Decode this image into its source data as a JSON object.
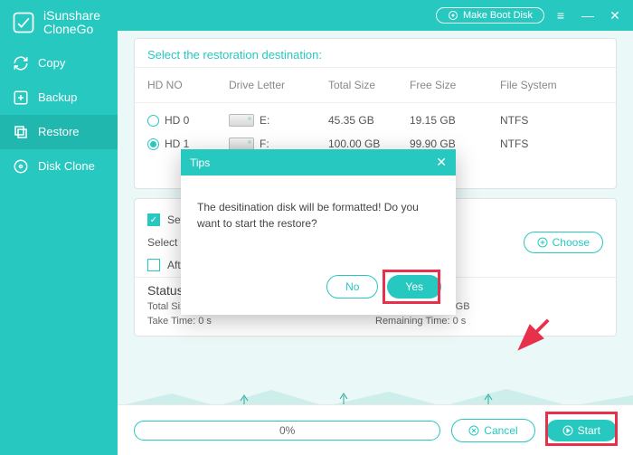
{
  "app": {
    "name1": "iSunshare",
    "name2": "CloneGo"
  },
  "topbar": {
    "boot": "Make Boot Disk"
  },
  "sidebar": {
    "items": [
      {
        "label": "Copy"
      },
      {
        "label": "Backup"
      },
      {
        "label": "Restore"
      },
      {
        "label": "Disk Clone"
      }
    ]
  },
  "table": {
    "title": "Select the restoration destination:",
    "headers": {
      "hd": "HD NO",
      "dl": "Drive Letter",
      "ts": "Total Size",
      "fs": "Free Size",
      "fsys": "File System"
    },
    "rows": [
      {
        "hd": "HD 0",
        "dl": "E:",
        "ts": "45.35 GB",
        "fs": "19.15 GB",
        "fsys": "NTFS",
        "selected": false
      },
      {
        "hd": "HD 1",
        "dl": "F:",
        "ts": "100.00 GB",
        "fs": "99.90 GB",
        "fsys": "NTFS",
        "selected": true
      }
    ]
  },
  "options": {
    "set_label": "Set t",
    "select_label": "Select a",
    "after_label": "After",
    "choose": "Choose"
  },
  "status": {
    "title": "Status:",
    "total": "Total Size: 0 GB",
    "restored": "Have Restored: 0 GB",
    "take": "Take Time: 0 s",
    "remain": "Remaining Time: 0 s"
  },
  "footer": {
    "progress": "0%",
    "cancel": "Cancel",
    "start": "Start"
  },
  "dialog": {
    "title": "Tips",
    "body": "The desitination disk will be formatted! Do you want to start the restore?",
    "no": "No",
    "yes": "Yes"
  }
}
